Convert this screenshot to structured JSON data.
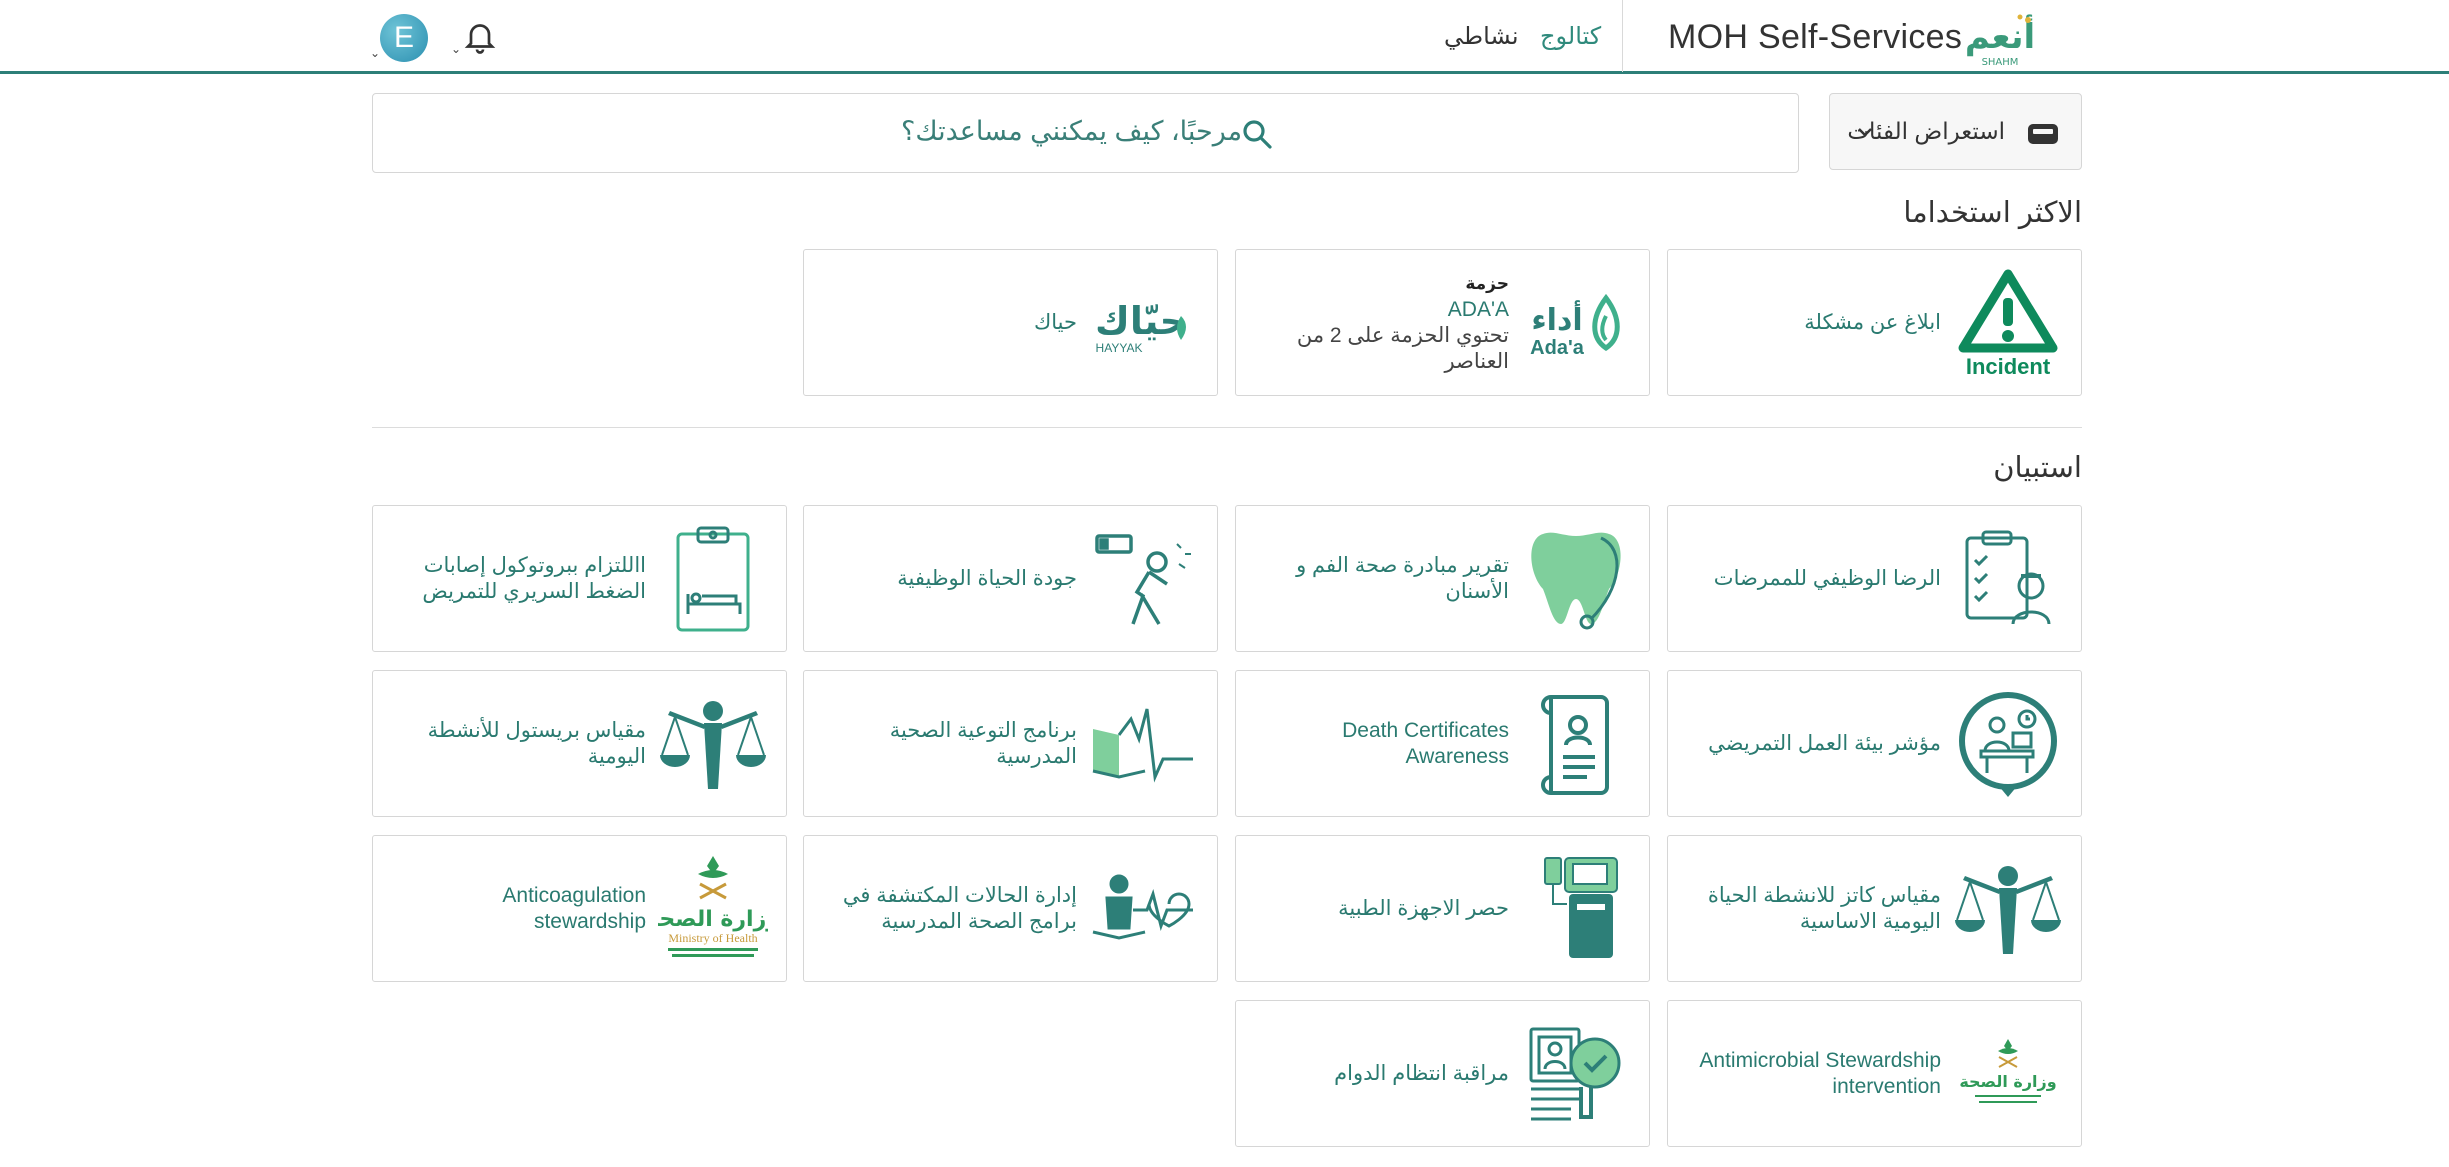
{
  "header": {
    "logo_text": "أنعم",
    "logo_subtext": "SHAHM",
    "app_title": "MOH Self-Services",
    "nav": [
      {
        "label": "كتالوج"
      },
      {
        "label": "نشاطي"
      }
    ],
    "avatar_letter": "E"
  },
  "toolbar": {
    "browse_categories_label": "استعراض الفئات",
    "search_placeholder": "مرحبًا، كيف يمكنني مساعدتك؟"
  },
  "sections": {
    "most_used": {
      "title": "الاكثر استخداما",
      "cards": [
        {
          "icon": "incident-warning-icon",
          "icon_text": "Incident",
          "label": "ابلاغ عن مشكلة"
        },
        {
          "icon": "adaa-logo-icon",
          "icon_text": "أداء Ada'a",
          "label_title": "حزمة",
          "label": "ADA'A",
          "label_extra": "تحتوي الحزمة على 2 من العناصر"
        },
        {
          "icon": "hayyak-logo-icon",
          "icon_text": "حيّاك HAYYAK",
          "label": "حياك"
        }
      ]
    },
    "surveys": {
      "title": "استبيان",
      "cards": [
        {
          "icon": "nurse-checklist-icon",
          "label": "الرضا الوظيفي للممرضات"
        },
        {
          "icon": "tooth-stethoscope-icon",
          "label": "تقرير مبادرة صحة الفم و الأسنان"
        },
        {
          "icon": "tired-worker-battery-icon",
          "label": "جودة الحياة الوظيفية"
        },
        {
          "icon": "clipboard-bed-icon",
          "label": "االلتزام ببروتوكول إصابات الضغط السريري للتمريض"
        },
        {
          "icon": "nurse-workstation-icon",
          "label": "مؤشر بيئة العمل التمريضي"
        },
        {
          "icon": "certificate-scroll-icon",
          "label": "Death Certificates Awareness"
        },
        {
          "icon": "book-heartbeat-icon",
          "label": "برنامج التوعية الصحية المدرسية"
        },
        {
          "icon": "balance-person-icon",
          "label": "مقياس بريستول للأنشطة اليومية"
        },
        {
          "icon": "balance-person-icon",
          "label": "مقياس كاتز للانشطة الحياة اليومية الاساسية"
        },
        {
          "icon": "medical-device-icon",
          "label": "حصر الاجهزة الطبية"
        },
        {
          "icon": "student-heartbeat-icon",
          "label": "إدارة الحالات المكتشفة في برامج الصحة المدرسية"
        },
        {
          "icon": "moh-logo-icon",
          "icon_text": "وزارة الصحة Ministry of Health",
          "label": "Anticoagulation stewardship"
        },
        {
          "icon": "moh-logo-icon",
          "icon_text": "وزارة الصحة",
          "label": "Antimicrobial Stewardship intervention"
        },
        {
          "icon": "attendance-magnifier-icon",
          "label": "مراقبة انتظام الدوام"
        }
      ]
    }
  },
  "colors": {
    "brand_green": "#2d7f78",
    "icon_green": "#0e8a5c",
    "text_teal": "#2a7a70"
  }
}
